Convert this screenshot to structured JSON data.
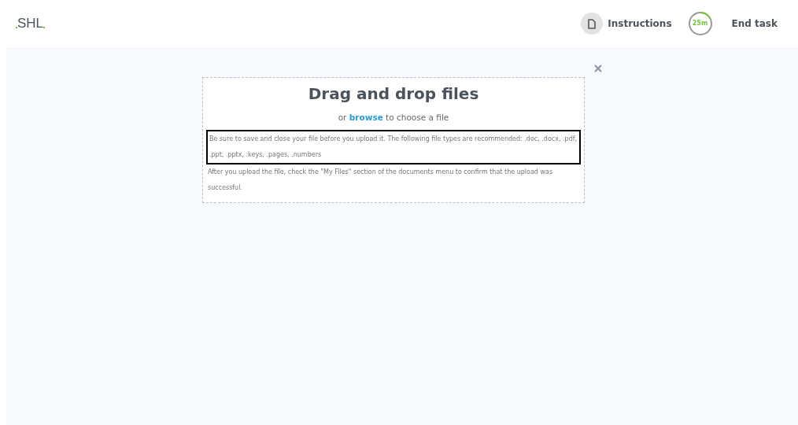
{
  "header": {
    "logo": "SHL",
    "instructions": "Instructions",
    "timer": {
      "label": "25m"
    },
    "end_task": "End task"
  },
  "upload_dialog": {
    "title": "Drag and drop files",
    "browse_prefix": "or ",
    "browse_link": "browse",
    "browse_suffix": " to choose a file",
    "notes": [
      {
        "text": "Be sure to save and close your file before you upload it. The following file types are recommended: .doc, .docx, .pdf, .ppt, .pptx, .keys, .pages, .numbers",
        "highlighted": true
      },
      {
        "text": "After you upload the file, check the \"My Files\" section of the documents menu to confirm that the upload was successful.",
        "highlighted": false
      }
    ]
  }
}
